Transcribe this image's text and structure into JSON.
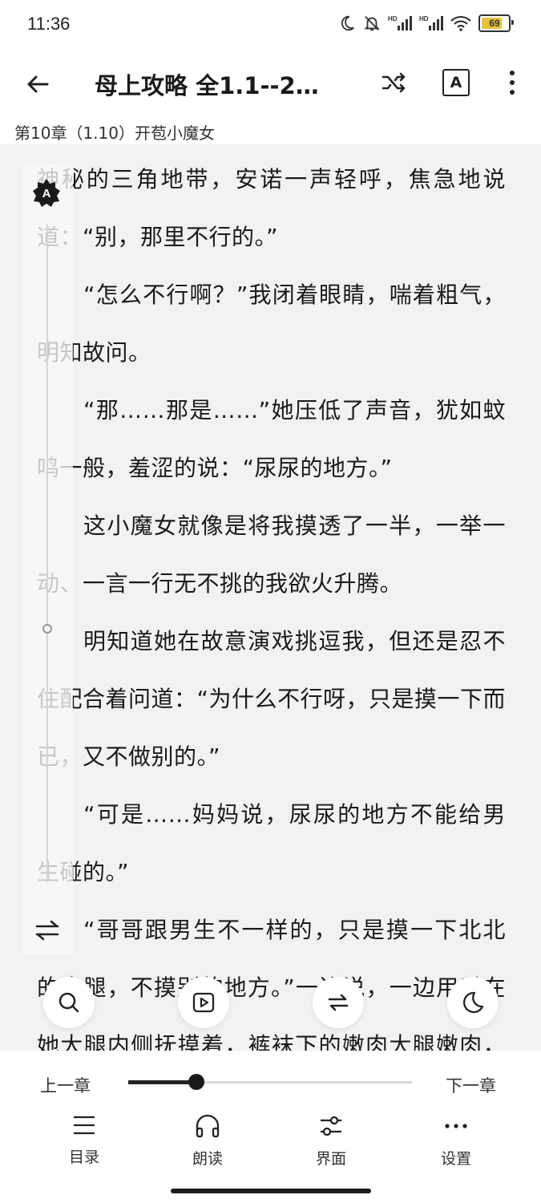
{
  "status_bar": {
    "time": "11:36",
    "icons": [
      "moon-icon",
      "bell-off-icon",
      "hd-signal-icon",
      "hd-signal-icon",
      "wifi-icon",
      "battery-icon"
    ],
    "battery": "69",
    "battery_level": 0.69,
    "battery_color": "#e7c23c"
  },
  "app_bar": {
    "title": "母上攻略 全1.1--2…",
    "icons": [
      "back-arrow-icon",
      "shuffle-icon",
      "text-a-icon",
      "more-vert-icon"
    ],
    "a_label": "A"
  },
  "chapter": {
    "title": "第10章（1.10）开苞小魔女"
  },
  "content": {
    "paragraphs": [
      "神秘的三角地带，安诺一声轻呼，焦急地说道：“别，那里不行的。”",
      "“怎么不行啊？”我闭着眼睛，喘着粗气，明知故问。",
      "“那……那是……”她压低了声音，犹如蚊鸣一般，羞涩的说：“尿尿的地方。”",
      "这小魔女就像是将我摸透了一半，一举一动、一言一行无不挑的我欲火升腾。",
      "明知道她在故意演戏挑逗我，但还是忍不住配合着问道：“为什么不行呀，只是摸一下而已，又不做别的。”",
      "“可是……妈妈说，尿尿的地方不能给男生碰的。”",
      "“哥哥跟男生不一样的，只是摸一下北北的大腿，不摸别的地方。”一边说，一边用手在她大腿内侧抚摸着，裤袜下的嫩肉大腿嫩肉，软绵绵、肉弹弹，简直叫人爱不释"
    ]
  },
  "side_panel": {
    "badge": "A",
    "icons": [
      "auto-a-icon",
      "swap-arrows-icon"
    ],
    "slider_level": 0.6
  },
  "floating_buttons": [
    "search-icon",
    "play-icon",
    "repeat-icon",
    "moon-icon"
  ],
  "bottom_panel": {
    "prev_chapter": "上一章",
    "next_chapter": "下一章",
    "progress": 0.24,
    "nav": [
      {
        "label": "目录",
        "icon": "list-icon"
      },
      {
        "label": "朗读",
        "icon": "headphones-icon"
      },
      {
        "label": "界面",
        "icon": "sliders-icon"
      },
      {
        "label": "设置",
        "icon": "more-horiz-icon"
      }
    ]
  }
}
